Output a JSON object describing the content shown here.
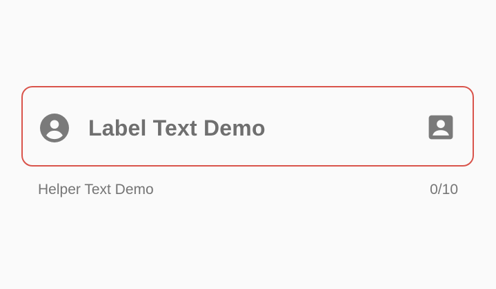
{
  "text_field": {
    "label": "Label Text Demo",
    "helper": "Helper Text Demo",
    "counter": "0/10",
    "leading_icon": "account-circle-icon",
    "trailing_icon": "account-box-icon",
    "outline_color": "#d9534a",
    "icon_color": "#7a7a7a",
    "label_color": "#6f6f6f"
  }
}
